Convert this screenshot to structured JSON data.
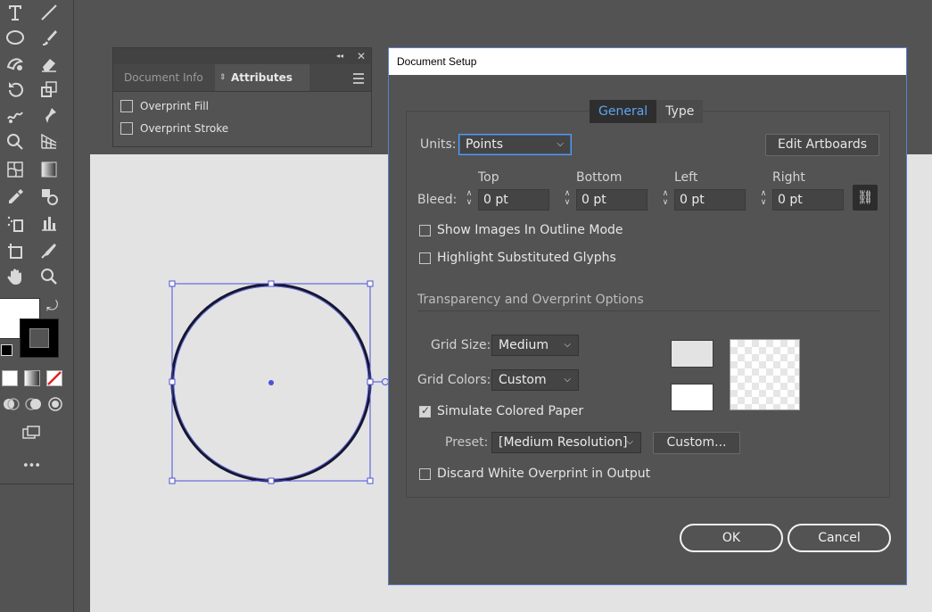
{
  "attributes_panel": {
    "tabs": [
      "Document Info",
      "Attributes"
    ],
    "active_tab": "Attributes",
    "checkboxes": [
      {
        "label": "Overprint Fill",
        "checked": false
      },
      {
        "label": "Overprint Stroke",
        "checked": false
      }
    ],
    "collapse_glyph": "◂◂",
    "close_glyph": "✕"
  },
  "dialog": {
    "title": "Document Setup",
    "tabs": [
      "General",
      "Type"
    ],
    "active_tab": "General",
    "units_label": "Units:",
    "units_value": "Points",
    "edit_artboards_label": "Edit Artboards",
    "bleed_label": "Bleed:",
    "bleed": {
      "top_label": "Top",
      "top_value": "0 pt",
      "bottom_label": "Bottom",
      "bottom_value": "0 pt",
      "left_label": "Left",
      "left_value": "0 pt",
      "right_label": "Right",
      "right_value": "0 pt"
    },
    "show_images_outline": {
      "label": "Show Images In Outline Mode",
      "checked": false
    },
    "highlight_glyphs": {
      "label": "Highlight Substituted Glyphs",
      "checked": false
    },
    "transparency_heading": "Transparency and Overprint Options",
    "grid_size_label": "Grid Size:",
    "grid_size_value": "Medium",
    "grid_colors_label": "Grid Colors:",
    "grid_colors_value": "Custom",
    "simulate_paper": {
      "label": "Simulate Colored Paper",
      "checked": true
    },
    "preset_label": "Preset:",
    "preset_value": "[Medium Resolution]",
    "custom_button_label": "Custom...",
    "discard_white": {
      "label": "Discard White Overprint in Output",
      "checked": false
    },
    "ok_label": "OK",
    "cancel_label": "Cancel",
    "link_icon_glyph": "⛓"
  },
  "toolbar": {
    "more_tools_glyph": "•••",
    "swap_glyph": "⤾"
  },
  "colors": {
    "accent": "#5ea5f2",
    "selection": "#4a52d8",
    "ui_background": "#535353",
    "artboard": "#e3e3e3"
  }
}
